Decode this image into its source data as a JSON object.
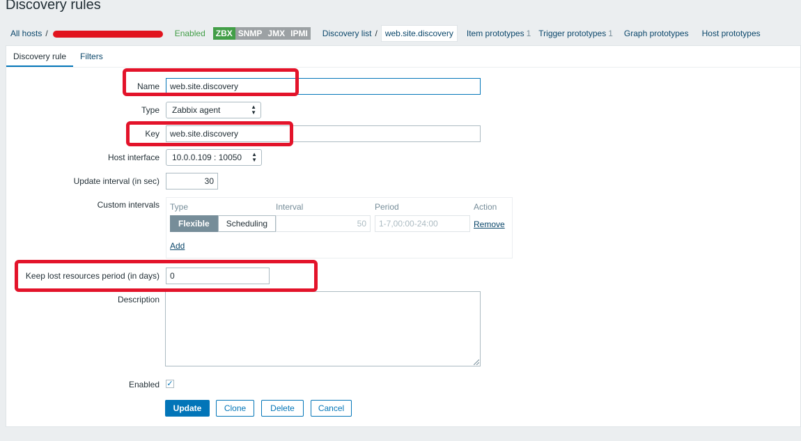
{
  "page": {
    "title": "Discovery rules"
  },
  "breadcrumb": {
    "all_hosts": "All hosts",
    "sep": "/",
    "status": "Enabled",
    "badges": [
      "ZBX",
      "SNMP",
      "JMX",
      "IPMI"
    ],
    "discovery_list": "Discovery list",
    "current": "web.site.discovery",
    "tabs": [
      {
        "label": "Item prototypes",
        "count": "1"
      },
      {
        "label": "Trigger prototypes",
        "count": "1"
      },
      {
        "label": "Graph prototypes",
        "count": ""
      },
      {
        "label": "Host prototypes",
        "count": ""
      }
    ]
  },
  "tabs": [
    "Discovery rule",
    "Filters"
  ],
  "form": {
    "name_label": "Name",
    "name_value": "web.site.discovery",
    "type_label": "Type",
    "type_value": "Zabbix agent",
    "key_label": "Key",
    "key_value": "web.site.discovery",
    "interface_label": "Host interface",
    "interface_value": "10.0.0.109 : 10050",
    "update_label": "Update interval (in sec)",
    "update_value": "30",
    "custom_label": "Custom intervals",
    "custom": {
      "headers": [
        "Type",
        "Interval",
        "Period",
        "Action"
      ],
      "type_options": [
        "Flexible",
        "Scheduling"
      ],
      "interval_value": "50",
      "period_placeholder": "1-7,00:00-24:00",
      "remove": "Remove",
      "add": "Add"
    },
    "keep_label": "Keep lost resources period (in days)",
    "keep_value": "0",
    "description_label": "Description",
    "enabled_label": "Enabled",
    "enabled_checked": true
  },
  "buttons": {
    "update": "Update",
    "clone": "Clone",
    "delete": "Delete",
    "cancel": "Cancel"
  },
  "colors": {
    "accent": "#0275b8",
    "enabled": "#429e47",
    "highlight": "#e3132a"
  }
}
